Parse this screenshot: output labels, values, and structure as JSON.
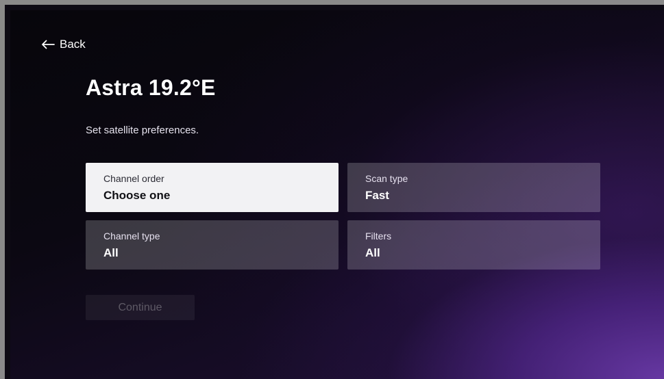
{
  "nav": {
    "back_label": "Back",
    "back_icon": "arrow-left-icon"
  },
  "header": {
    "title": "Astra 19.2°E",
    "subtitle": "Set satellite preferences."
  },
  "settings": [
    {
      "label": "Channel order",
      "value": "Choose one",
      "focused": true
    },
    {
      "label": "Scan type",
      "value": "Fast",
      "focused": false
    },
    {
      "label": "Channel type",
      "value": "All",
      "focused": false
    },
    {
      "label": "Filters",
      "value": "All",
      "focused": false
    }
  ],
  "actions": {
    "continue_label": "Continue",
    "continue_enabled": false
  },
  "colors": {
    "background_dark": "#0b0812",
    "accent_purple": "#6a3aa8",
    "focused_tile": "#f2f2f4"
  }
}
